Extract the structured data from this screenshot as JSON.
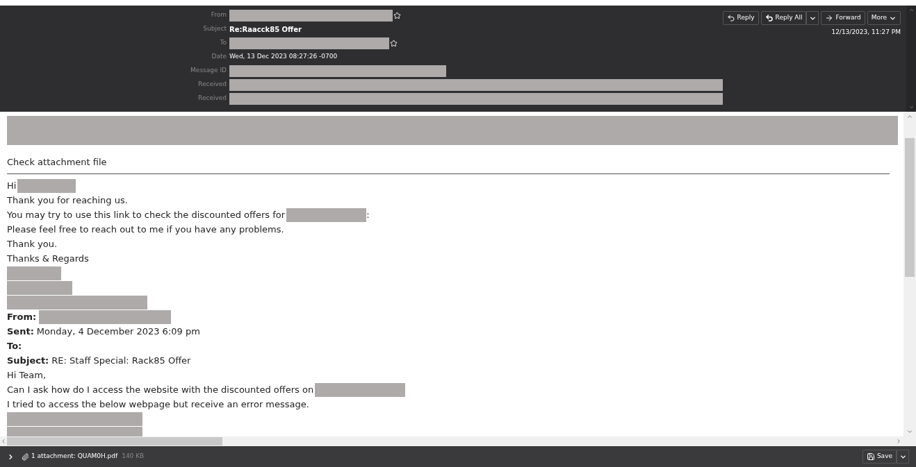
{
  "header": {
    "fields": [
      {
        "label": "From",
        "redacted": true,
        "star": true
      },
      {
        "label": "Subject",
        "value": "Re:Raacck85 Offer",
        "redacted": false,
        "star": false
      },
      {
        "label": "To",
        "redacted": true,
        "star": true
      },
      {
        "label": "Date",
        "value": "Wed, 13 Dec 2023 08:27:26 -0700",
        "redacted": false,
        "star": false
      },
      {
        "label": "Message ID",
        "redacted": true,
        "star": false
      },
      {
        "label": "Received",
        "redacted": true,
        "star": false
      },
      {
        "label": "Received",
        "redacted": true,
        "star": false
      }
    ],
    "buttons": [
      {
        "kind": "reply",
        "label": "Reply"
      },
      {
        "kind": "reply_all",
        "label": "Reply All"
      },
      {
        "kind": "forward",
        "label": "Forward"
      },
      {
        "kind": "more",
        "label": "More"
      }
    ],
    "timestamp": "12/13/2023, 11:27 PM"
  },
  "body": {
    "intro": "Check attachment file",
    "lines": [
      {
        "kind": "text",
        "text": "Hi",
        "redacted": true
      },
      {
        "kind": "text",
        "text": "Thank you for reaching us.",
        "redacted": false
      },
      {
        "kind": "text",
        "text": "You may try to use this link to check the discounted offers for",
        "redacted": true,
        "suffix": ":"
      },
      {
        "kind": "text",
        "text": "Please feel free to reach out to me if you have any problems.",
        "redacted": false
      },
      {
        "kind": "text",
        "text": "Thank you.",
        "redacted": false
      },
      {
        "kind": "text",
        "text": "Thanks & Regards",
        "redacted": false
      },
      {
        "kind": "redaction"
      },
      {
        "kind": "redaction"
      },
      {
        "kind": "redaction"
      },
      {
        "kind": "field",
        "label": "From:",
        "redacted": true
      },
      {
        "kind": "field",
        "label": "Sent:",
        "value": "Monday, 4 December 2023 6:09 pm",
        "redacted": false
      },
      {
        "kind": "field",
        "label": "To:",
        "redacted": false
      },
      {
        "kind": "field",
        "label": "Subject:",
        "value": "RE: Staff Special: Rack85 Offer",
        "redacted": false
      },
      {
        "kind": "text",
        "text": "Hi Team,",
        "redacted": false
      },
      {
        "kind": "text",
        "text": "Can I ask how do I access the website with the discounted offers on",
        "redacted": true
      },
      {
        "kind": "text",
        "text": "I tried to access the below webpage but receive an error message.",
        "redacted": false
      },
      {
        "kind": "redaction"
      },
      {
        "kind": "redaction"
      }
    ]
  },
  "footer": {
    "attachment": "1 attachment: QUAM0H.pdf",
    "size": "140 KB",
    "save": "Save"
  }
}
